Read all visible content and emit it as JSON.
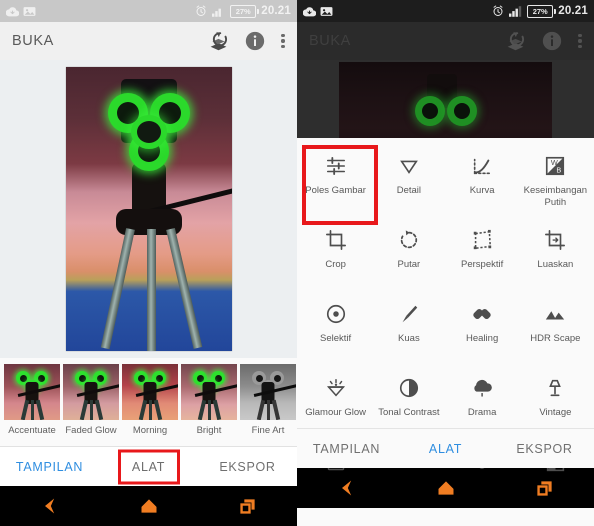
{
  "status_bar": {
    "left_icons": [
      "cloud-download-icon",
      "image-icon"
    ],
    "alarm_icon": "alarm-icon",
    "signal_icon": "signal-bars-icon",
    "battery_text": "27%",
    "time": "20.21"
  },
  "toolbar": {
    "title": "BUKA",
    "actions": [
      "stack-undo-icon",
      "info-icon",
      "overflow-menu-icon"
    ]
  },
  "left_screen": {
    "filters": [
      {
        "label": "Accentuate"
      },
      {
        "label": "Faded Glow"
      },
      {
        "label": "Morning"
      },
      {
        "label": "Bright"
      },
      {
        "label": "Fine Art"
      }
    ],
    "tabs": [
      {
        "label": "TAMPILAN",
        "state": "active"
      },
      {
        "label": "ALAT",
        "state": "highlighted"
      },
      {
        "label": "EKSPOR",
        "state": "normal"
      }
    ]
  },
  "right_screen": {
    "tools": [
      {
        "label": "Poles Gambar",
        "icon": "sliders-icon",
        "highlighted": true
      },
      {
        "label": "Detail",
        "icon": "triangle-down-icon",
        "highlighted": false
      },
      {
        "label": "Kurva",
        "icon": "curve-icon",
        "highlighted": false
      },
      {
        "label": "Keseimbangan Putih",
        "icon": "white-balance-icon",
        "highlighted": false
      },
      {
        "label": "Crop",
        "icon": "crop-icon",
        "highlighted": false
      },
      {
        "label": "Putar",
        "icon": "rotate-icon",
        "highlighted": false
      },
      {
        "label": "Perspektif",
        "icon": "perspective-icon",
        "highlighted": false
      },
      {
        "label": "Luaskan",
        "icon": "expand-icon",
        "highlighted": false
      },
      {
        "label": "Selektif",
        "icon": "selective-dot-icon",
        "highlighted": false
      },
      {
        "label": "Kuas",
        "icon": "brush-icon",
        "highlighted": false
      },
      {
        "label": "Healing",
        "icon": "healing-patch-icon",
        "highlighted": false
      },
      {
        "label": "HDR Scape",
        "icon": "mountains-icon",
        "highlighted": false
      },
      {
        "label": "Glamour Glow",
        "icon": "glamour-gem-icon",
        "highlighted": false
      },
      {
        "label": "Tonal Contrast",
        "icon": "contrast-circle-icon",
        "highlighted": false
      },
      {
        "label": "Drama",
        "icon": "cloud-icon",
        "highlighted": false
      },
      {
        "label": "Vintage",
        "icon": "lamp-icon",
        "highlighted": false
      },
      {
        "label": "",
        "icon": "grain-icon",
        "highlighted": false
      },
      {
        "label": "",
        "icon": "moustache-icon",
        "highlighted": false
      },
      {
        "label": "",
        "icon": "portrait-head-icon",
        "highlighted": false
      },
      {
        "label": "",
        "icon": "frames-icon",
        "highlighted": false
      }
    ],
    "tabs": [
      {
        "label": "TAMPILAN",
        "state": "normal"
      },
      {
        "label": "ALAT",
        "state": "active"
      },
      {
        "label": "EKSPOR",
        "state": "normal"
      }
    ]
  },
  "nav_bar": {
    "back": "back-triangle-icon",
    "home": "home-icon",
    "recents": "recents-icon"
  },
  "colors": {
    "accent_blue": "#2f8ee0",
    "highlight_red": "#e8181b",
    "nav_orange": "#f07d22"
  }
}
